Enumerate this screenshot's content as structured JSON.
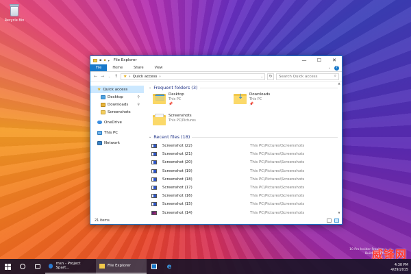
{
  "desktop": {
    "recycle_bin_label": "Recycle Bin"
  },
  "window": {
    "title": "File Explorer",
    "controls": {
      "minimize": "—",
      "maximize": "☐",
      "close": "✕"
    },
    "ribbon": {
      "tabs": [
        {
          "label": "File"
        },
        {
          "label": "Home"
        },
        {
          "label": "Share"
        },
        {
          "label": "View"
        }
      ],
      "help": "?"
    },
    "address": {
      "star": "★",
      "path": "Quick access",
      "separator": "›",
      "search_placeholder": "Search Quick access"
    },
    "nav_pane": {
      "items": [
        {
          "label": "Quick access",
          "icon": "star-icon",
          "level": 0,
          "pinned": false
        },
        {
          "label": "Desktop",
          "icon": "desktop-folder-icon",
          "level": 1,
          "pinned": true
        },
        {
          "label": "Downloads",
          "icon": "downloads-folder-icon",
          "level": 1,
          "pinned": true
        },
        {
          "label": "Screenshots",
          "icon": "folder-icon",
          "level": 1,
          "pinned": false
        },
        {
          "label": "OneDrive",
          "icon": "onedrive-icon",
          "level": 0,
          "pinned": false
        },
        {
          "label": "This PC",
          "icon": "pc-icon",
          "level": 0,
          "pinned": false
        },
        {
          "label": "Network",
          "icon": "network-icon",
          "level": 0,
          "pinned": false
        }
      ]
    },
    "frequent": {
      "header": "Frequent folders (3)",
      "folders": [
        {
          "name": "Desktop",
          "location": "This PC",
          "pin": "📌"
        },
        {
          "name": "Downloads",
          "location": "This PC",
          "pin": "📌"
        },
        {
          "name": "Screenshots",
          "location": "This PC\\Pictures",
          "pin": ""
        }
      ]
    },
    "recent": {
      "header": "Recent files (18)",
      "files": [
        {
          "name": "Screenshot (22)",
          "path": "This PC\\Pictures\\Screenshots"
        },
        {
          "name": "Screenshot (21)",
          "path": "This PC\\Pictures\\Screenshots"
        },
        {
          "name": "Screenshot (20)",
          "path": "This PC\\Pictures\\Screenshots"
        },
        {
          "name": "Screenshot (19)",
          "path": "This PC\\Pictures\\Screenshots"
        },
        {
          "name": "Screenshot (18)",
          "path": "This PC\\Pictures\\Screenshots"
        },
        {
          "name": "Screenshot (17)",
          "path": "This PC\\Pictures\\Screenshots"
        },
        {
          "name": "Screenshot (16)",
          "path": "This PC\\Pictures\\Screenshots"
        },
        {
          "name": "Screenshot (15)",
          "path": "This PC\\Pictures\\Screenshots"
        },
        {
          "name": "Screenshot (14)",
          "path": "This PC\\Pictures\\Screenshots"
        }
      ]
    },
    "status": {
      "item_count": "21 items"
    }
  },
  "taskbar": {
    "apps": [
      {
        "label": "msn - Project Spart...",
        "active": false
      },
      {
        "label": "File Explorer",
        "active": true
      }
    ],
    "tray": {
      "watermark_line1": "10 Pro Insider Preview",
      "watermark_line2": "Build 10074",
      "time": "4:30 PM",
      "date": "4/29/2015"
    },
    "brand_overlay": "威锋网"
  },
  "colors": {
    "accent": "#1979ca",
    "section_header": "#1e3287",
    "selection": "#cce8ff"
  }
}
